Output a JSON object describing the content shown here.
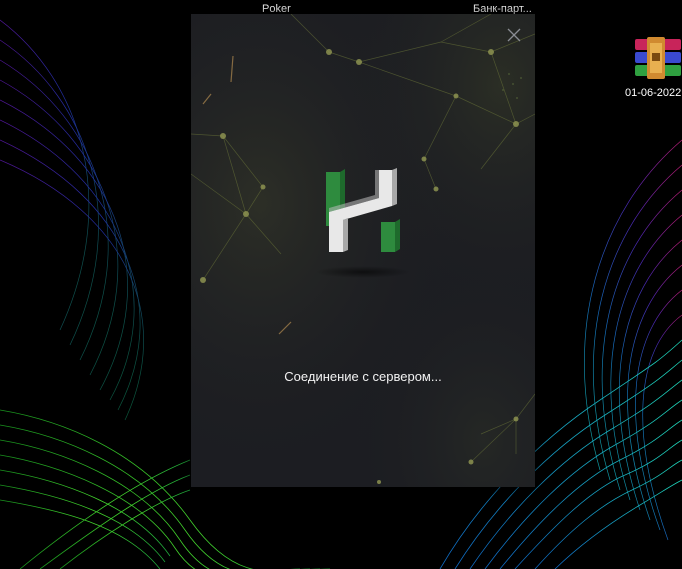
{
  "desktop": {
    "icons": [
      {
        "label": "Poker"
      },
      {
        "label": "Банк-парт..."
      },
      {
        "label": "01-06-2022",
        "icon": "winrar-archive-icon"
      }
    ]
  },
  "launcher": {
    "status": "Соединение с сервером...",
    "close_icon": "close-icon",
    "logo_icon": "h-logo-icon",
    "colors": {
      "background": "#1c1d22",
      "accent_green": "#2e8b3e",
      "logo_white": "#e8e8e8"
    }
  }
}
